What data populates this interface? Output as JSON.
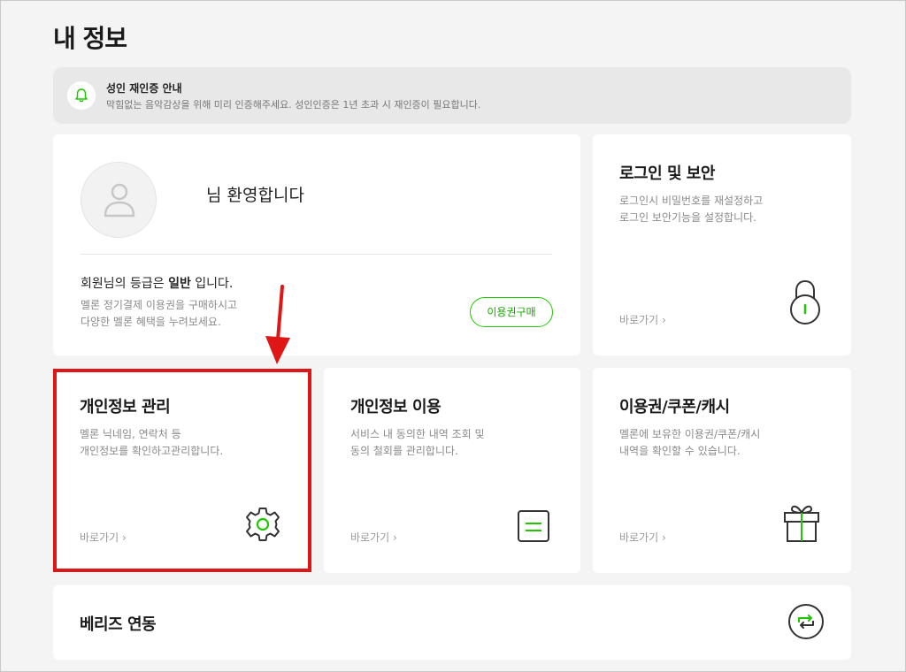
{
  "page": {
    "title": "내 정보"
  },
  "notice": {
    "icon": "bell-icon",
    "title": "성인 재인증 안내",
    "desc": "막힘없는 음악감상을 위해 미리 인증해주세요. 성인인증은 1년 초과 시 재인증이 필요합니다."
  },
  "profile": {
    "avatar_icon": "user-icon",
    "welcome": "님 환영합니다",
    "grade_prefix": "회원님의 등급은",
    "grade_value": "일반",
    "grade_suffix": "입니다.",
    "grade_desc_line1": "멜론 정기결제 이용권을 구매하시고",
    "grade_desc_line2": "다양한 멜론 혜택을 누려보세요.",
    "buy_button": "이용권구매"
  },
  "tiles": {
    "login": {
      "title": "로그인 및 보안",
      "desc_line1": "로그인시 비밀번호를 재설정하고",
      "desc_line2": "로그인 보안기능을 설정합니다.",
      "link": "바로가기 ›",
      "icon": "lock-icon"
    },
    "privacy_manage": {
      "title": "개인정보 관리",
      "desc_line1": "멜론 닉네임, 연락처 등",
      "desc_line2": "개인정보를 확인하고관리합니다.",
      "link": "바로가기 ›",
      "icon": "gear-icon"
    },
    "privacy_use": {
      "title": "개인정보 이용",
      "desc_line1": "서비스 내 동의한 내역 조회 및",
      "desc_line2": "동의 철회를 관리합니다.",
      "link": "바로가기 ›",
      "icon": "document-icon"
    },
    "tickets": {
      "title": "이용권/쿠폰/캐시",
      "desc_line1": "멜론에 보유한 이용권/쿠폰/캐시",
      "desc_line2": "내역을 확인할 수 있습니다.",
      "link": "바로가기 ›",
      "icon": "gift-icon"
    },
    "berry": {
      "title": "베리즈 연동",
      "icon": "sync-icon"
    }
  },
  "annotation": {
    "arrow_icon": "arrow-down-icon",
    "highlight_color": "#e01515"
  },
  "colors": {
    "accent": "#1ec800",
    "background": "#f4f4f4",
    "card": "#ffffff"
  }
}
